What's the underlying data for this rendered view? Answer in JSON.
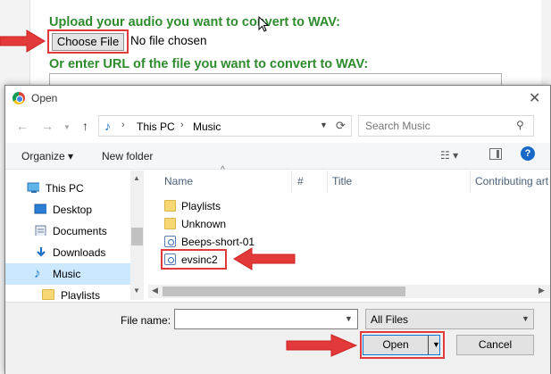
{
  "background_page": {
    "upload_heading": "Upload your audio you want to convert to WAV:",
    "choose_file_label": "Choose File",
    "no_file_text": "No file chosen",
    "url_heading": "Or enter URL of the file you want to convert to WAV:"
  },
  "dialog": {
    "title": "Open",
    "address": {
      "crumbs": [
        "This PC",
        "Music"
      ]
    },
    "search": {
      "placeholder": "Search Music"
    },
    "toolbar": {
      "organize_label": "Organize ▾",
      "new_folder_label": "New folder"
    },
    "nav_pane": {
      "items": [
        {
          "label": "This PC",
          "icon": "computer-icon"
        },
        {
          "label": "Desktop",
          "icon": "desktop-icon"
        },
        {
          "label": "Documents",
          "icon": "documents-icon"
        },
        {
          "label": "Downloads",
          "icon": "downloads-icon"
        },
        {
          "label": "Music",
          "icon": "music-icon",
          "selected": true
        },
        {
          "label": "Playlists",
          "icon": "folder-icon"
        }
      ]
    },
    "file_list": {
      "columns": [
        "Name",
        "#",
        "Title",
        "Contributing art"
      ],
      "files": [
        {
          "name": "Playlists",
          "icon": "folder-icon"
        },
        {
          "name": "Unknown",
          "icon": "folder-icon"
        },
        {
          "name": "Beeps-short-01",
          "icon": "audio-file-icon"
        },
        {
          "name": "evsinc2",
          "icon": "audio-file-icon",
          "highlighted": true
        }
      ]
    },
    "bottom": {
      "file_name_label": "File name:",
      "file_name_value": "",
      "filter_value": "All Files",
      "open_label": "Open",
      "cancel_label": "Cancel"
    }
  },
  "colors": {
    "heading_green": "#2e8b2e",
    "annotation_red": "#e23a3a",
    "selection_blue": "#cce8ff"
  }
}
